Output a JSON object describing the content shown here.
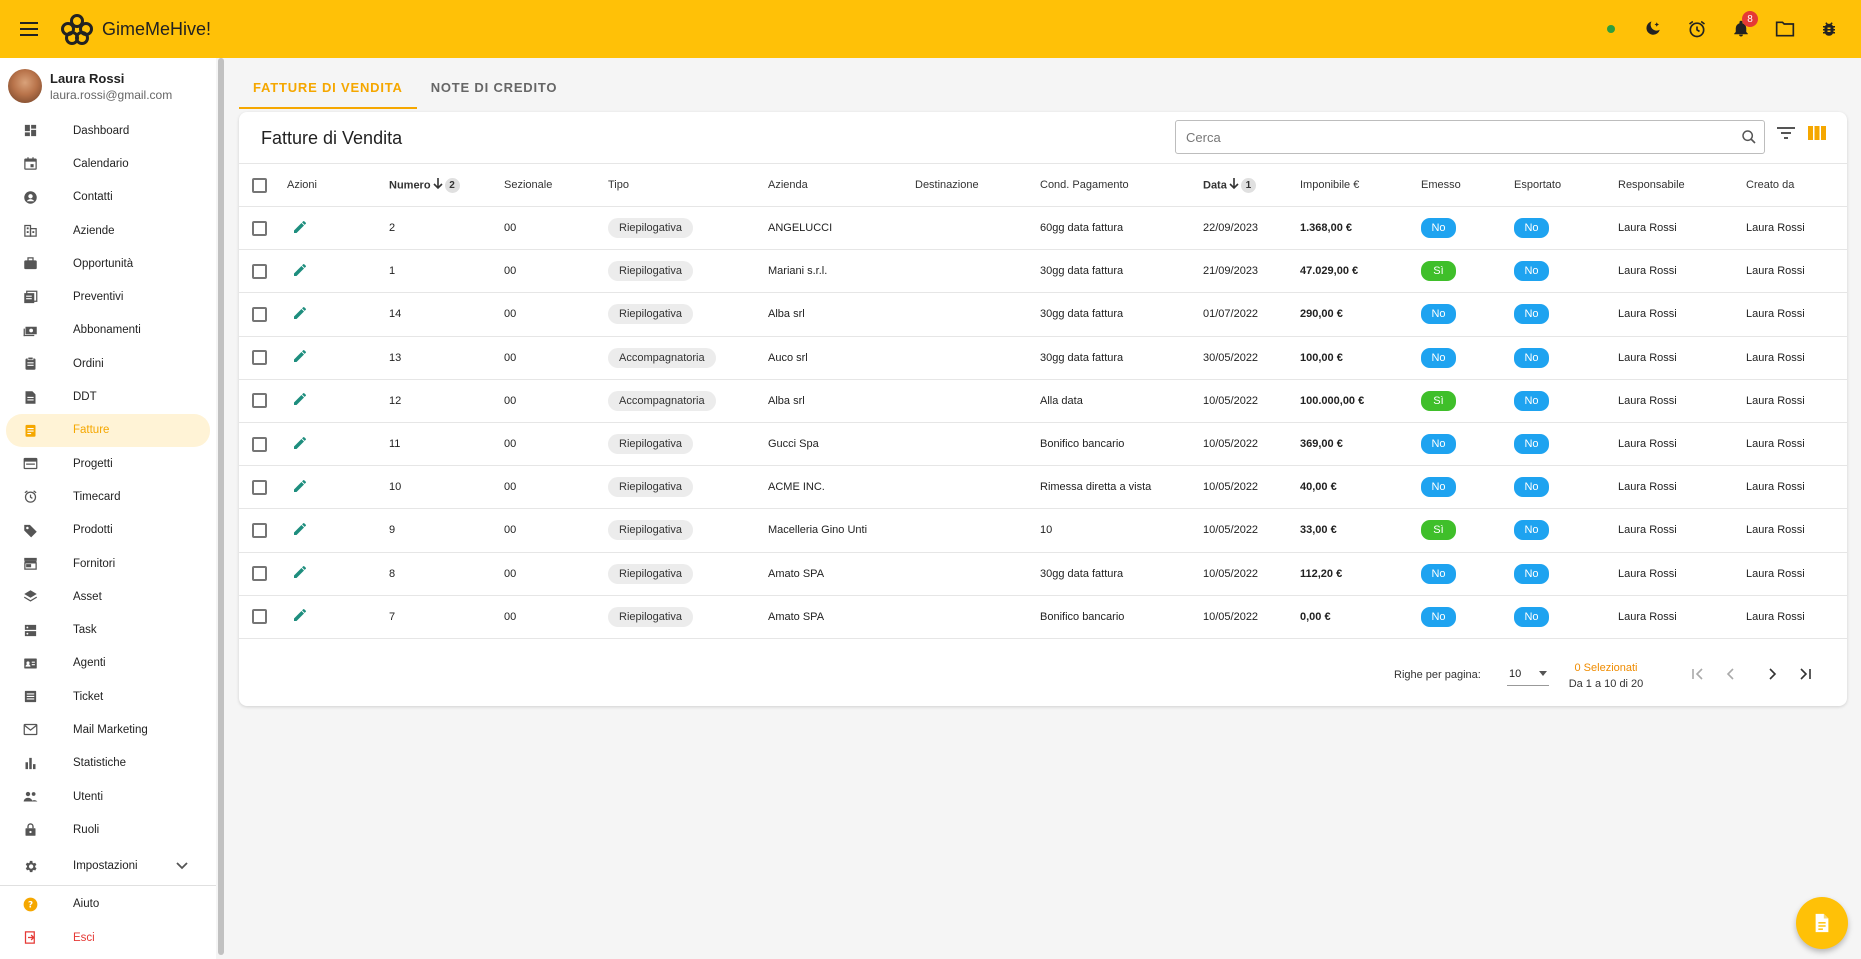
{
  "app": {
    "title": "GimeMeHive!",
    "notification_count": "8"
  },
  "user": {
    "name": "Laura Rossi",
    "email": "laura.rossi@gmail.com"
  },
  "sidebar": {
    "items": [
      {
        "label": "Dashboard",
        "icon": "dashboard-icon"
      },
      {
        "label": "Calendario",
        "icon": "calendar-icon"
      },
      {
        "label": "Contatti",
        "icon": "contact-icon"
      },
      {
        "label": "Aziende",
        "icon": "building-icon"
      },
      {
        "label": "Opportunità",
        "icon": "briefcase-icon"
      },
      {
        "label": "Preventivi",
        "icon": "quote-icon"
      },
      {
        "label": "Abbonamenti",
        "icon": "subscription-icon"
      },
      {
        "label": "Ordini",
        "icon": "clipboard-icon"
      },
      {
        "label": "DDT",
        "icon": "document-icon"
      },
      {
        "label": "Fatture",
        "icon": "invoice-icon",
        "active": true
      },
      {
        "label": "Progetti",
        "icon": "project-icon"
      },
      {
        "label": "Timecard",
        "icon": "clock-icon"
      },
      {
        "label": "Prodotti",
        "icon": "tag-icon"
      },
      {
        "label": "Fornitori",
        "icon": "store-icon"
      },
      {
        "label": "Asset",
        "icon": "layers-icon"
      },
      {
        "label": "Task",
        "icon": "task-icon"
      },
      {
        "label": "Agenti",
        "icon": "badge-icon"
      },
      {
        "label": "Ticket",
        "icon": "ticket-icon"
      },
      {
        "label": "Mail Marketing",
        "icon": "mail-icon"
      },
      {
        "label": "Statistiche",
        "icon": "chart-icon"
      },
      {
        "label": "Utenti",
        "icon": "users-icon"
      },
      {
        "label": "Ruoli",
        "icon": "lock-icon"
      }
    ],
    "settings_label": "Impostazioni",
    "help_label": "Aiuto",
    "logout_label": "Esci"
  },
  "tabs": [
    "FATTURE DI VENDITA",
    "NOTE DI CREDITO"
  ],
  "card": {
    "title": "Fatture di Vendita",
    "search_placeholder": "Cerca"
  },
  "table": {
    "headers": {
      "azioni": "Azioni",
      "numero": "Numero",
      "numero_sort": "2",
      "sezionale": "Sezionale",
      "tipo": "Tipo",
      "azienda": "Azienda",
      "destinazione": "Destinazione",
      "cond": "Cond. Pagamento",
      "data": "Data",
      "data_sort": "1",
      "imponibile": "Imponibile €",
      "emesso": "Emesso",
      "esportato": "Esportato",
      "responsabile": "Responsabile",
      "creato": "Creato da"
    },
    "rows": [
      {
        "numero": "2",
        "sezionale": "00",
        "tipo": "Riepilogativa",
        "azienda": "ANGELUCCI",
        "destinazione": "",
        "cond": "60gg data fattura",
        "data": "22/09/2023",
        "imponibile": "1.368,00 €",
        "emesso": "No",
        "esportato": "No",
        "responsabile": "Laura Rossi",
        "creato": "Laura Rossi"
      },
      {
        "numero": "1",
        "sezionale": "00",
        "tipo": "Riepilogativa",
        "azienda": "Mariani s.r.l.",
        "destinazione": "",
        "cond": "30gg data fattura",
        "data": "21/09/2023",
        "imponibile": "47.029,00 €",
        "emesso": "Sì",
        "esportato": "No",
        "responsabile": "Laura Rossi",
        "creato": "Laura Rossi"
      },
      {
        "numero": "14",
        "sezionale": "00",
        "tipo": "Riepilogativa",
        "azienda": "Alba srl",
        "destinazione": "",
        "cond": "30gg data fattura",
        "data": "01/07/2022",
        "imponibile": "290,00 €",
        "emesso": "No",
        "esportato": "No",
        "responsabile": "Laura Rossi",
        "creato": "Laura Rossi"
      },
      {
        "numero": "13",
        "sezionale": "00",
        "tipo": "Accompagnatoria",
        "azienda": "Auco srl",
        "destinazione": "",
        "cond": "30gg data fattura",
        "data": "30/05/2022",
        "imponibile": "100,00 €",
        "emesso": "No",
        "esportato": "No",
        "responsabile": "Laura Rossi",
        "creato": "Laura Rossi"
      },
      {
        "numero": "12",
        "sezionale": "00",
        "tipo": "Accompagnatoria",
        "azienda": "Alba srl",
        "destinazione": "",
        "cond": "Alla data",
        "data": "10/05/2022",
        "imponibile": "100.000,00 €",
        "emesso": "Sì",
        "esportato": "No",
        "responsabile": "Laura Rossi",
        "creato": "Laura Rossi"
      },
      {
        "numero": "11",
        "sezionale": "00",
        "tipo": "Riepilogativa",
        "azienda": "Gucci Spa",
        "destinazione": "",
        "cond": "Bonifico bancario",
        "data": "10/05/2022",
        "imponibile": "369,00 €",
        "emesso": "No",
        "esportato": "No",
        "responsabile": "Laura Rossi",
        "creato": "Laura Rossi"
      },
      {
        "numero": "10",
        "sezionale": "00",
        "tipo": "Riepilogativa",
        "azienda": "ACME INC.",
        "destinazione": "",
        "cond": "Rimessa diretta a vista",
        "data": "10/05/2022",
        "imponibile": "40,00 €",
        "emesso": "No",
        "esportato": "No",
        "responsabile": "Laura Rossi",
        "creato": "Laura Rossi"
      },
      {
        "numero": "9",
        "sezionale": "00",
        "tipo": "Riepilogativa",
        "azienda": "Macelleria Gino Unti",
        "destinazione": "",
        "cond": "10",
        "data": "10/05/2022",
        "imponibile": "33,00 €",
        "emesso": "Sì",
        "esportato": "No",
        "responsabile": "Laura Rossi",
        "creato": "Laura Rossi"
      },
      {
        "numero": "8",
        "sezionale": "00",
        "tipo": "Riepilogativa",
        "azienda": "Amato SPA",
        "destinazione": "",
        "cond": "30gg data fattura",
        "data": "10/05/2022",
        "imponibile": "112,20 €",
        "emesso": "No",
        "esportato": "No",
        "responsabile": "Laura Rossi",
        "creato": "Laura Rossi"
      },
      {
        "numero": "7",
        "sezionale": "00",
        "tipo": "Riepilogativa",
        "azienda": "Amato SPA",
        "destinazione": "",
        "cond": "Bonifico bancario",
        "data": "10/05/2022",
        "imponibile": "0,00 €",
        "emesso": "No",
        "esportato": "No",
        "responsabile": "Laura Rossi",
        "creato": "Laura Rossi"
      }
    ]
  },
  "pagination": {
    "rows_per_page_label": "Righe per pagina:",
    "rows_per_page": "10",
    "selected": "0 Selezionati",
    "range": "Da 1 a 10 di 20"
  },
  "colors": {
    "accent": "#ffc107",
    "active_text": "#f5a700",
    "edit_icon": "#1e8e7e",
    "pill_blue": "#1ea3f0",
    "pill_green": "#3fbf2a"
  }
}
